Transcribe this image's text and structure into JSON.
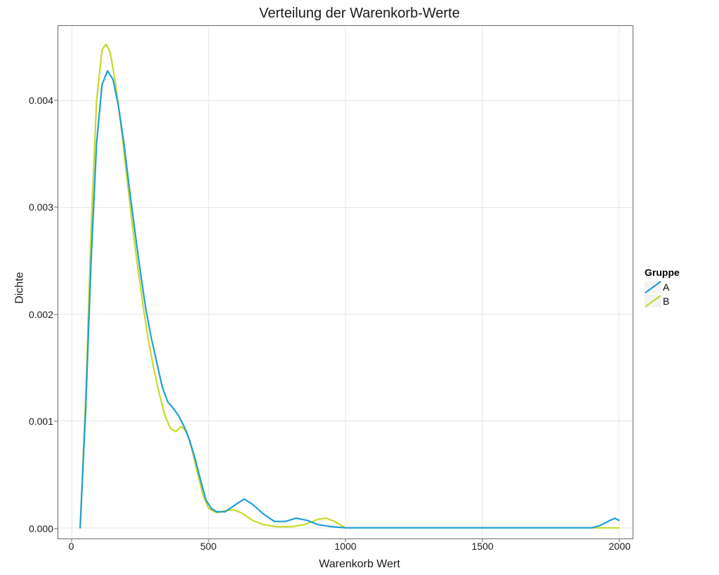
{
  "chart_data": {
    "type": "line",
    "title": "Verteilung der Warenkorb-Werte",
    "xlabel": "Warenkorb Wert",
    "ylabel": "Dichte",
    "xlim": [
      -50,
      2050
    ],
    "ylim": [
      -0.0001,
      0.0047
    ],
    "xticks": [
      0,
      500,
      1000,
      1500,
      2000
    ],
    "yticks": [
      0.0,
      0.001,
      0.002,
      0.003,
      0.004
    ],
    "ytick_labels": [
      "0.000",
      "0.001",
      "0.002",
      "0.003",
      "0.004"
    ],
    "legend": {
      "title": "Gruppe",
      "items": [
        {
          "name": "A",
          "color": "#1f9dd9"
        },
        {
          "name": "B",
          "color": "#c8d926"
        }
      ]
    },
    "series": [
      {
        "name": "A",
        "color": "#1f9dd9",
        "x": [
          30,
          50,
          70,
          90,
          110,
          130,
          150,
          170,
          190,
          210,
          230,
          250,
          270,
          290,
          310,
          330,
          350,
          370,
          390,
          410,
          430,
          450,
          470,
          490,
          510,
          530,
          560,
          600,
          630,
          660,
          700,
          740,
          780,
          820,
          860,
          900,
          950,
          1000,
          1900,
          1930,
          1960,
          1985,
          2000
        ],
        "y": [
          0.0,
          0.0011,
          0.0025,
          0.0036,
          0.00415,
          0.00428,
          0.0042,
          0.00395,
          0.0036,
          0.00318,
          0.00278,
          0.0024,
          0.00205,
          0.00178,
          0.00155,
          0.00132,
          0.00118,
          0.00112,
          0.00105,
          0.00095,
          0.00082,
          0.00065,
          0.00045,
          0.00026,
          0.00018,
          0.00015,
          0.00015,
          0.00022,
          0.00027,
          0.00022,
          0.00013,
          6e-05,
          6e-05,
          9e-05,
          7e-05,
          3e-05,
          1e-05,
          0.0,
          0.0,
          2e-05,
          6e-05,
          9e-05,
          7e-05
        ]
      },
      {
        "name": "B",
        "color": "#c8d926",
        "x": [
          30,
          50,
          70,
          90,
          110,
          125,
          140,
          160,
          180,
          200,
          220,
          240,
          260,
          280,
          300,
          320,
          340,
          360,
          380,
          400,
          420,
          440,
          460,
          480,
          500,
          530,
          560,
          590,
          620,
          660,
          700,
          750,
          800,
          850,
          900,
          930,
          960,
          1000,
          2000
        ],
        "y": [
          0.0,
          0.0012,
          0.0028,
          0.004,
          0.00448,
          0.00453,
          0.00445,
          0.00415,
          0.00375,
          0.0033,
          0.00285,
          0.00245,
          0.00208,
          0.00175,
          0.00148,
          0.00125,
          0.00105,
          0.00093,
          0.0009,
          0.00095,
          0.0009,
          0.00072,
          0.0005,
          0.0003,
          0.00018,
          0.00014,
          0.00016,
          0.00017,
          0.00014,
          7e-05,
          3e-05,
          1e-05,
          1e-05,
          3e-05,
          8e-05,
          9e-05,
          6e-05,
          0.0,
          0.0
        ]
      }
    ]
  }
}
